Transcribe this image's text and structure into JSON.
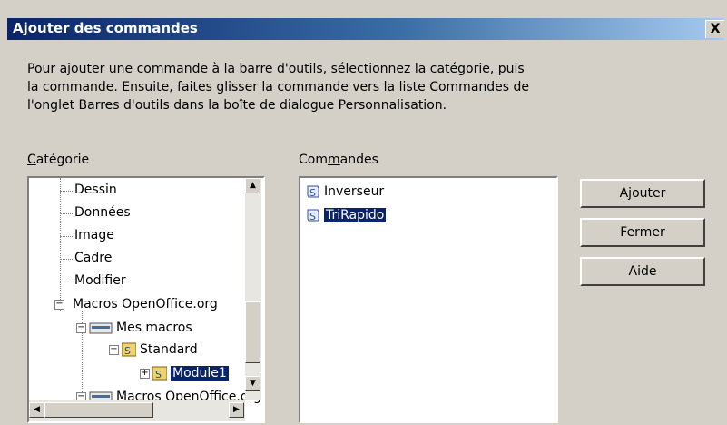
{
  "window": {
    "title": "Ajouter des commandes",
    "close_label": "X"
  },
  "instructions": "Pour ajouter une commande à la barre d'outils, sélectionnez la catégorie, puis la commande. Ensuite, faites glisser la commande vers la liste Commandes de l'onglet Barres d'outils dans la boîte de dialogue Personnalisation.",
  "category_label": {
    "mnemonic": "C",
    "rest": "atégorie"
  },
  "commands_label": {
    "before": "Com",
    "mnemonic": "m",
    "rest": "andes"
  },
  "category_tree": [
    {
      "label": "Dessin"
    },
    {
      "label": "Données"
    },
    {
      "label": "Image"
    },
    {
      "label": "Cadre"
    },
    {
      "label": "Modifier"
    },
    {
      "label": "Macros OpenOffice.org",
      "expander": "−"
    },
    {
      "label": "Mes macros",
      "expander": "−",
      "icon": "folder-icon"
    },
    {
      "label": "Standard",
      "expander": "−",
      "icon": "macro-library-icon"
    },
    {
      "label": "Module1",
      "expander": "+",
      "icon": "macro-library-icon",
      "selected": true
    },
    {
      "label": "Macros OpenOffice.org",
      "expander": "−",
      "icon": "folder-icon",
      "partial": true
    }
  ],
  "commands": [
    {
      "label": "Inverseur",
      "icon": "basic-script-icon",
      "selected": false
    },
    {
      "label": "TriRapido",
      "icon": "basic-script-icon",
      "selected": true
    }
  ],
  "buttons": {
    "add": "Ajouter",
    "close": "Fermer",
    "help": "Aide"
  },
  "colors": {
    "selection": "#0a246a",
    "title_start": "#0a246a",
    "title_end": "#a6caf0",
    "dialog_bg": "#d4d0c8"
  }
}
